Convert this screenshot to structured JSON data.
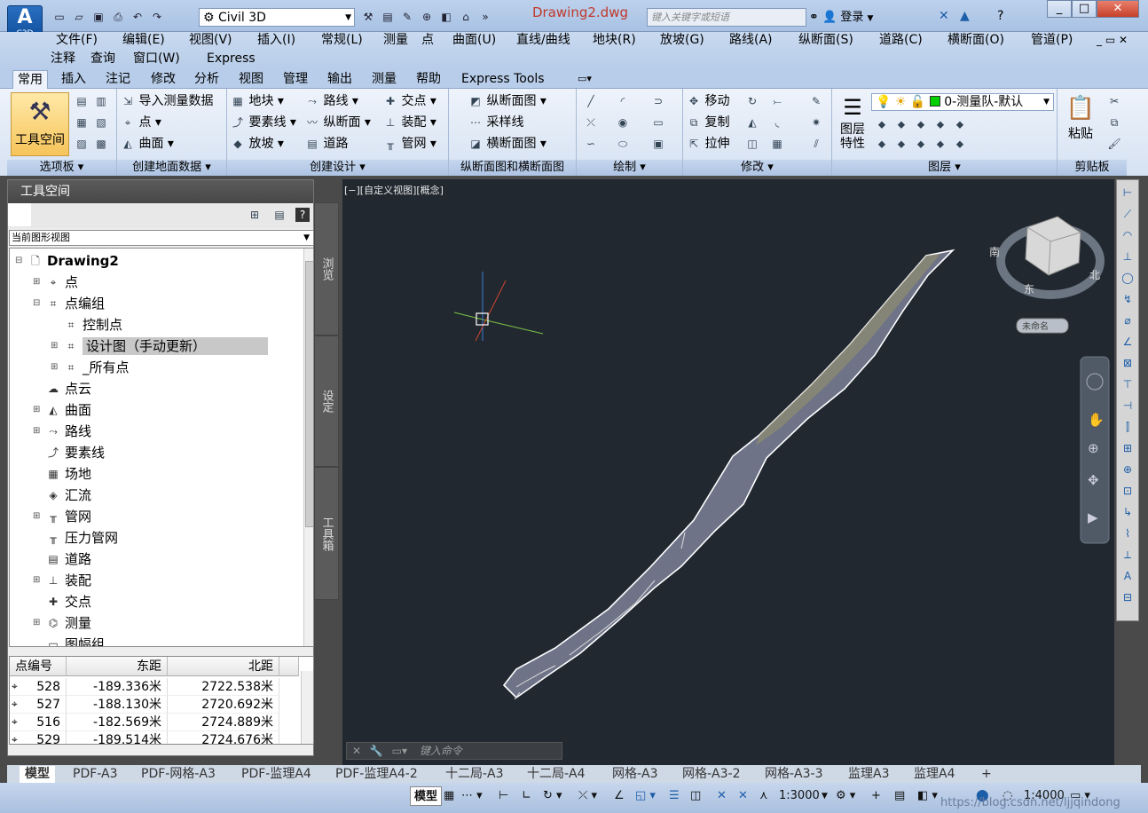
{
  "app": {
    "title": "Drawing2.dwg",
    "logo_label": "C3D",
    "workspace": "Civil 3D",
    "search_placeholder": "键入关键字或短语",
    "login": "登录"
  },
  "menu": {
    "row1": [
      "文件(F)",
      "编辑(E)",
      "视图(V)",
      "插入(I)",
      "常规(L)",
      "测量",
      "点",
      "曲面(U)",
      "直线/曲线",
      "地块(R)",
      "放坡(G)",
      "路线(A)",
      "纵断面(S)",
      "道路(C)",
      "横断面(O)",
      "管道(P)"
    ],
    "row2": [
      "注释",
      "查询",
      "窗口(W)",
      "Express"
    ]
  },
  "ribbon_tabs": [
    "常用",
    "插入",
    "注记",
    "修改",
    "分析",
    "视图",
    "管理",
    "输出",
    "测量",
    "帮助",
    "Express Tools"
  ],
  "ribbon": {
    "toolspace_btn": "工具空间",
    "p1_title": "选项板",
    "p2": {
      "title": "创建地面数据",
      "b1": "导入测量数据",
      "b2": "点",
      "b3": "曲面"
    },
    "p3": {
      "title": "创建设计",
      "b1": "地块",
      "b2": "要素线",
      "b3": "放坡",
      "b4": "路线",
      "b5": "纵断面",
      "b6": "道路",
      "b7": "交点",
      "b8": "装配",
      "b9": "管网"
    },
    "p4": {
      "title": "纵断面图和横断面图",
      "b1": "纵断面图",
      "b2": "采样线",
      "b3": "横断面图"
    },
    "p5": {
      "title": "绘制"
    },
    "p6": {
      "title": "修改",
      "b1": "移动",
      "b2": "复制",
      "b3": "拉伸"
    },
    "p7": {
      "title": "图层",
      "btn": "图层特性",
      "layer": "0-测量队-默认"
    },
    "p8": {
      "title": "剪贴板",
      "btn": "粘贴"
    }
  },
  "toolspace": {
    "title": "工具空间",
    "view_select": "当前图形视图",
    "side_tabs": [
      "浏览",
      "设定",
      "工具箱"
    ],
    "tree": [
      {
        "label": "Drawing2",
        "icon": "doc-icon"
      },
      {
        "label": "点",
        "icon": "point-icon"
      },
      {
        "label": "点编组",
        "icon": "point-group-icon"
      },
      {
        "label": "控制点",
        "icon": "point-group-icon"
      },
      {
        "label": "设计图（手动更新）",
        "icon": "point-group-icon"
      },
      {
        "label": "_所有点",
        "icon": "point-group-icon"
      },
      {
        "label": "点云",
        "icon": "cloud-icon"
      },
      {
        "label": "曲面",
        "icon": "surface-icon"
      },
      {
        "label": "路线",
        "icon": "alignment-icon"
      },
      {
        "label": "要素线",
        "icon": "featureline-icon"
      },
      {
        "label": "场地",
        "icon": "site-icon"
      },
      {
        "label": "汇流",
        "icon": "catchment-icon"
      },
      {
        "label": "管网",
        "icon": "pipe-icon"
      },
      {
        "label": "压力管网",
        "icon": "pressure-pipe-icon"
      },
      {
        "label": "道路",
        "icon": "corridor-icon"
      },
      {
        "label": "装配",
        "icon": "assembly-icon"
      },
      {
        "label": "交点",
        "icon": "intersection-icon"
      },
      {
        "label": "测量",
        "icon": "survey-icon"
      },
      {
        "label": "图幅组",
        "icon": "sheet-icon"
      }
    ],
    "grid": {
      "headers": [
        "点编号",
        "东距",
        "北距"
      ],
      "rows": [
        [
          "528",
          "-189.336米",
          "2722.538米"
        ],
        [
          "527",
          "-188.130米",
          "2720.692米"
        ],
        [
          "516",
          "-182.569米",
          "2724.889米"
        ],
        [
          "529",
          "-189.514米",
          "2724.676米"
        ]
      ]
    }
  },
  "viewport": {
    "label": "[−][自定义视图][概念]",
    "viewcube_label": "未命名",
    "compass": [
      "南",
      "东",
      "北"
    ],
    "command_placeholder": "键入命令"
  },
  "layout_tabs": [
    "模型",
    "PDF-A3",
    "PDF-网格-A3",
    "PDF-监理A4",
    "PDF-监理A4-2",
    "十二局-A3",
    "十二局-A4",
    "网格-A3",
    "网格-A3-2",
    "网格-A3-3",
    "监理A3",
    "监理A4"
  ],
  "status": {
    "model": "模型",
    "scale1": "1:3000",
    "scale2": "1:4000",
    "watermark": "https://blog.csdn.net/ljjqindong"
  }
}
